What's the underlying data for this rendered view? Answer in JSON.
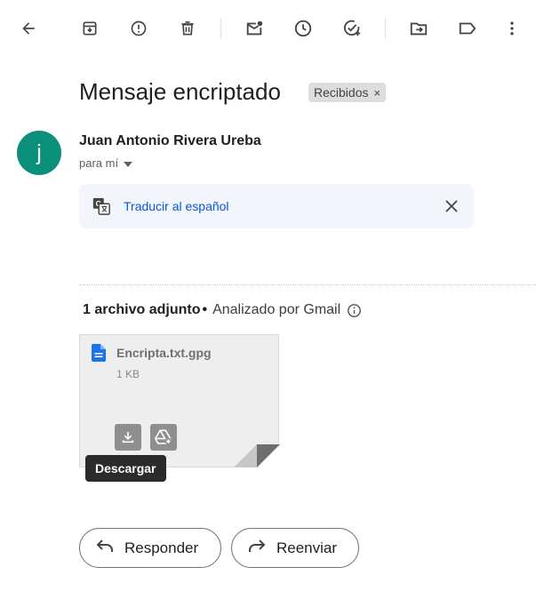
{
  "toolbar": {
    "icons": [
      "back-arrow-icon",
      "archive-icon",
      "report-spam-icon",
      "delete-icon",
      "mark-unread-icon",
      "snooze-icon",
      "add-task-icon",
      "move-to-icon",
      "label-icon",
      "more-vert-icon"
    ]
  },
  "email": {
    "subject": "Mensaje encriptado",
    "label": "Recibidos",
    "label_remove": "×",
    "sender_initial": "j",
    "sender_name": "Juan Antonio Rivera Ureba",
    "recipient": "para mí"
  },
  "translate": {
    "link": "Traducir al español"
  },
  "attachments": {
    "count_label": "1 archivo adjunto",
    "separator": "•",
    "scanned_label": "Analizado por Gmail",
    "file": {
      "name": "Encripta.txt.gpg",
      "size": "1 KB"
    },
    "tooltip": "Descargar"
  },
  "actions": {
    "reply": "Responder",
    "forward": "Reenviar"
  },
  "colors": {
    "avatar": "#0a8f7b",
    "link": "#0b57d0",
    "file_icon": "#1a73e8"
  }
}
